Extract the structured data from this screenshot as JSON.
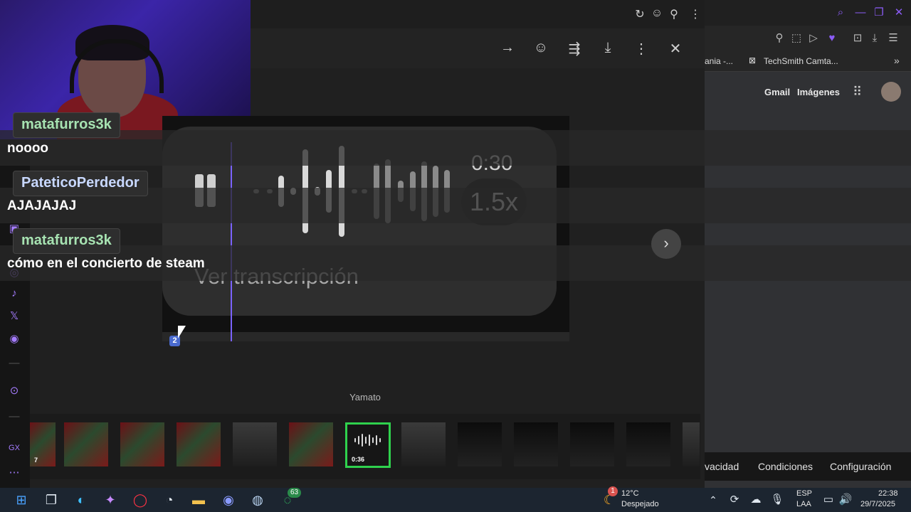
{
  "webcam": {
    "alt": "streamer webcam"
  },
  "viewer": {
    "top_icons": [
      "refresh-icon",
      "emoji-icon",
      "pin-icon",
      "more-icon"
    ],
    "actions": [
      "forward-icon",
      "react-icon",
      "share-icon",
      "download-icon",
      "more-icon",
      "close-icon"
    ],
    "caption": "Yamato"
  },
  "voice_note": {
    "duration": "0:30",
    "speed": "1.5x",
    "transcription_label": "Ver transcripción"
  },
  "chat": [
    {
      "user": "matafurros3k",
      "message": "noooo"
    },
    {
      "user": "PateticoPerdedor",
      "message": "AJAJAJAJ"
    },
    {
      "user": "matafurros3k",
      "message": "cómo en el concierto de steam"
    }
  ],
  "badge_count": "2",
  "thumbnails": [
    {
      "label": "7"
    },
    {
      "label": ""
    },
    {
      "label": ""
    },
    {
      "label": ""
    },
    {
      "label": ""
    },
    {
      "label": ""
    },
    {
      "label": "0:36",
      "selected": true
    },
    {
      "label": ""
    },
    {
      "label": ""
    },
    {
      "label": ""
    },
    {
      "label": ""
    },
    {
      "label": ""
    },
    {
      "label": ""
    }
  ],
  "browser": {
    "bookmarks": [
      "ania -...",
      "TechSmith Camta..."
    ],
    "header_links": [
      "Gmail",
      "Imágenes"
    ],
    "footer_links": [
      "vacidad",
      "Condiciones",
      "Configuración"
    ]
  },
  "taskbar": {
    "weather_temp": "12°C",
    "weather_desc": "Despejado",
    "weather_badge": "1",
    "whatsapp_badge": "63",
    "lang_top": "ESP",
    "lang_bottom": "LAA",
    "time": "22:38",
    "date": "29/7/2025"
  },
  "colors": {
    "accent": "#8b5cf6",
    "selected_thumb": "#2fd14d"
  }
}
